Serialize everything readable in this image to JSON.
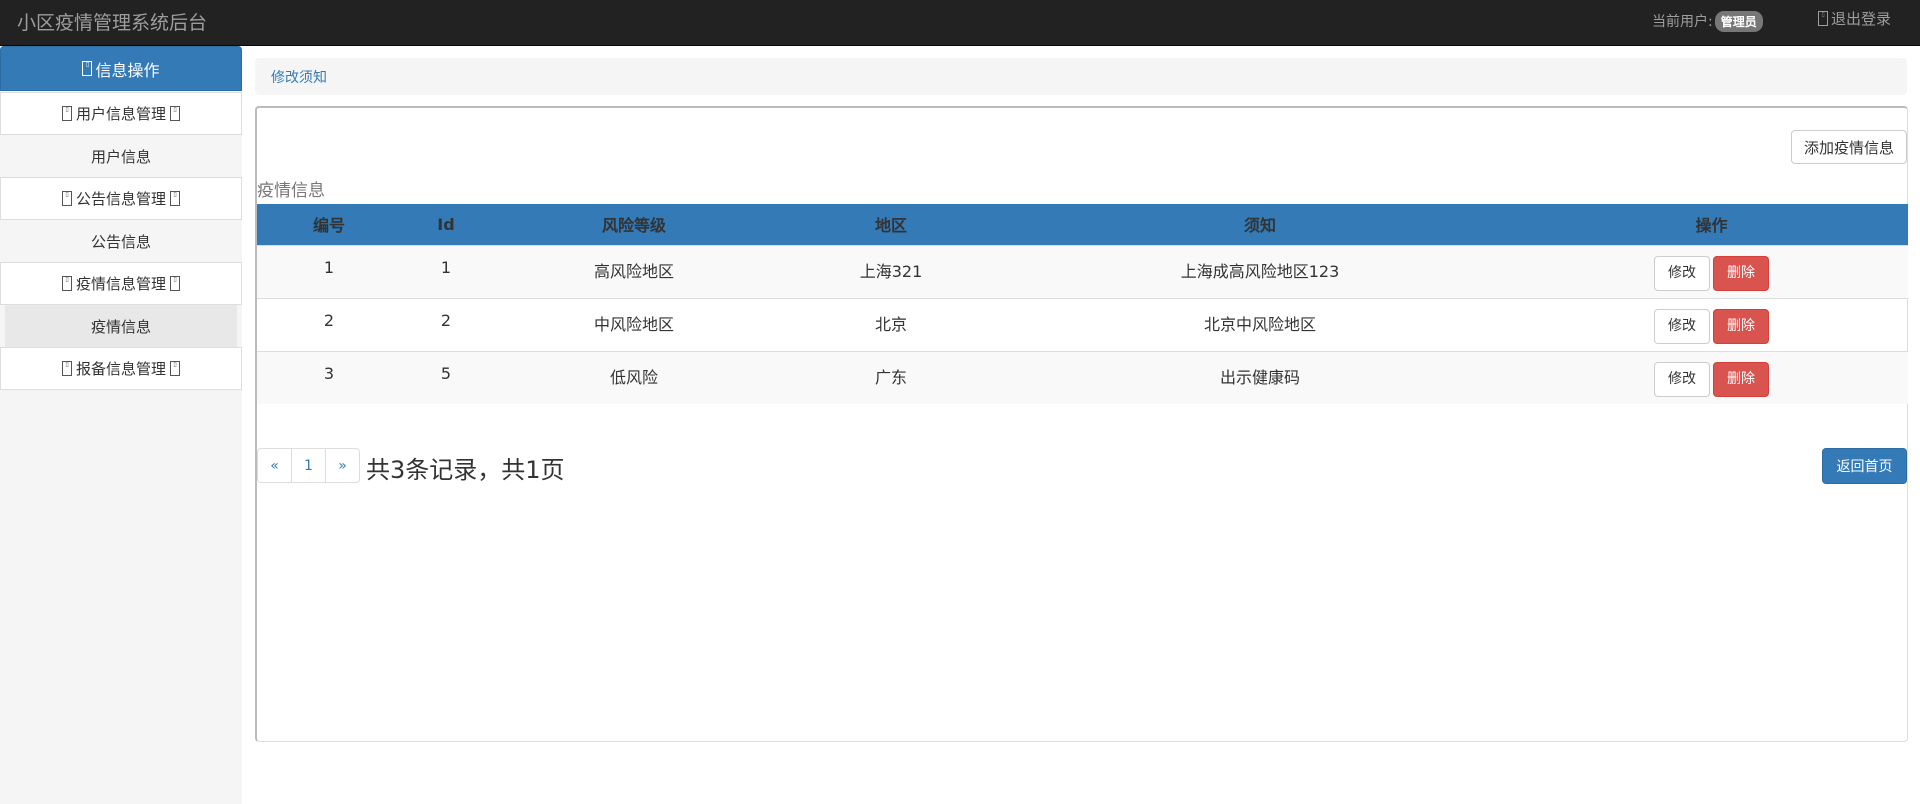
{
  "app": {
    "title": "小区疫情管理系统后台"
  },
  "header": {
    "current_user_label": "当前用户:",
    "user_badge": "管理员",
    "logout_label": "退出登录"
  },
  "sidebar": {
    "heading": "信息操作",
    "groups": [
      {
        "label": "用户信息管理",
        "sub": "用户信息"
      },
      {
        "label": "公告信息管理",
        "sub": "公告信息"
      },
      {
        "label": "疫情信息管理",
        "sub": "疫情信息"
      },
      {
        "label": "报备信息管理"
      }
    ]
  },
  "breadcrumb": {
    "link": "修改须知"
  },
  "panel": {
    "add_button": "添加疫情信息",
    "caption": "疫情信息",
    "columns": [
      "编号",
      "Id",
      "风险等级",
      "地区",
      "须知",
      "操作"
    ],
    "rows": [
      {
        "no": "1",
        "id": "1",
        "risk": "高风险地区",
        "region": "上海321",
        "notice": "上海成高风险地区123"
      },
      {
        "no": "2",
        "id": "2",
        "risk": "中风险地区",
        "region": "北京",
        "notice": "北京中风险地区"
      },
      {
        "no": "3",
        "id": "5",
        "risk": "低风险",
        "region": "广东",
        "notice": "出示健康码"
      }
    ],
    "edit_label": "修改",
    "delete_label": "删除",
    "pager": {
      "prev": "«",
      "page": "1",
      "next": "»"
    },
    "records_text": "共3条记录，共1页",
    "home_button": "返回首页"
  },
  "colors": {
    "navbar": "#222222",
    "primary": "#337ab7",
    "danger": "#d9534f"
  }
}
